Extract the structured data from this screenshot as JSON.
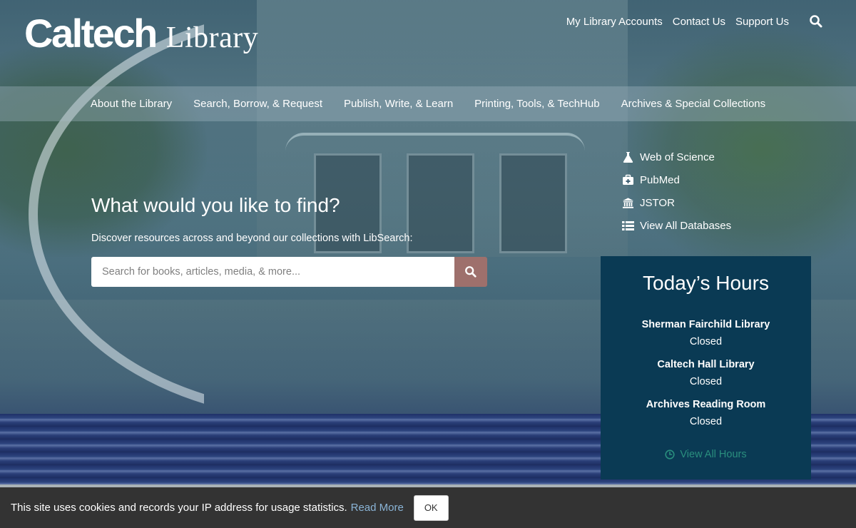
{
  "brand": {
    "logo_main": "Caltech",
    "logo_sub": "Library"
  },
  "utility_nav": {
    "items": [
      "My Library Accounts",
      "Contact Us",
      "Support Us"
    ],
    "search_icon": "search-icon"
  },
  "main_nav": {
    "items": [
      "About the Library",
      "Search, Borrow, & Request",
      "Publish, Write, & Learn",
      "Printing, Tools, & TechHub",
      "Archives & Special Collections"
    ]
  },
  "search": {
    "title": "What would you like to find?",
    "subtitle": "Discover resources across and beyond our collections with LibSearch:",
    "placeholder": "Search for books, articles, media, & more...",
    "button_color": "#9e706c"
  },
  "quick_links": [
    {
      "label": "Web of Science",
      "icon": "flask-icon"
    },
    {
      "label": "PubMed",
      "icon": "medkit-icon"
    },
    {
      "label": "JSTOR",
      "icon": "institution-icon"
    },
    {
      "label": "View All Databases",
      "icon": "list-icon"
    }
  ],
  "hours": {
    "title": "Today’s Hours",
    "libraries": [
      {
        "name": "Sherman Fairchild Library",
        "status": "Closed"
      },
      {
        "name": "Caltech Hall Library",
        "status": "Closed"
      },
      {
        "name": "Archives Reading Room",
        "status": "Closed"
      }
    ],
    "view_all": "View All Hours",
    "panel_color": "#0a3a54",
    "link_color": "#2a8f7e"
  },
  "cookie_bar": {
    "message": "This site uses cookies and records your IP address for usage statistics.",
    "read_more": "Read More",
    "ok_label": "OK"
  }
}
